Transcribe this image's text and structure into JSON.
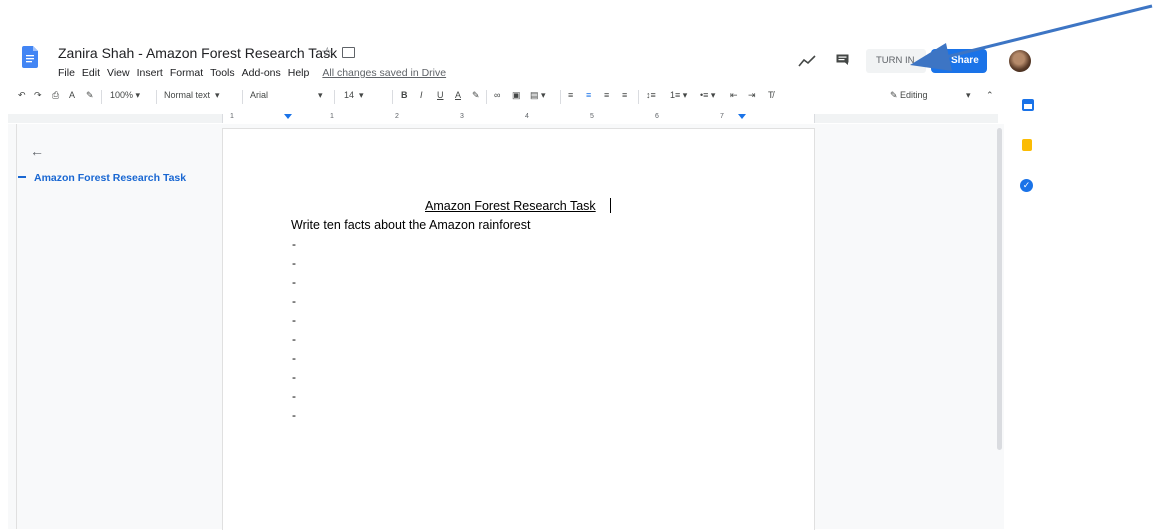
{
  "header": {
    "doc_title": "Zanira Shah - Amazon Forest Research Task",
    "menu": [
      "File",
      "Edit",
      "View",
      "Insert",
      "Format",
      "Tools",
      "Add-ons",
      "Help"
    ],
    "save_status": "All changes saved in Drive",
    "turn_in_label": "TURN IN",
    "share_label": "Share"
  },
  "toolbar": {
    "zoom": "100%",
    "style": "Normal text",
    "font": "Arial",
    "font_size": "14",
    "mode": "Editing"
  },
  "ruler": {
    "numbers": [
      "1",
      "1",
      "2",
      "3",
      "4",
      "5",
      "6",
      "7"
    ]
  },
  "outline": {
    "items": [
      "Amazon Forest Research Task"
    ]
  },
  "document": {
    "heading": "Amazon Forest Research Task",
    "intro": "Write ten facts about the Amazon rainforest",
    "bullets": [
      "-",
      "-",
      "-",
      "-",
      "-",
      "-",
      "-",
      "-",
      "-",
      "-"
    ]
  },
  "colors": {
    "accent": "#1a73e8",
    "outline_text": "#1967d2",
    "annotation_arrow": "#3d75c4"
  }
}
